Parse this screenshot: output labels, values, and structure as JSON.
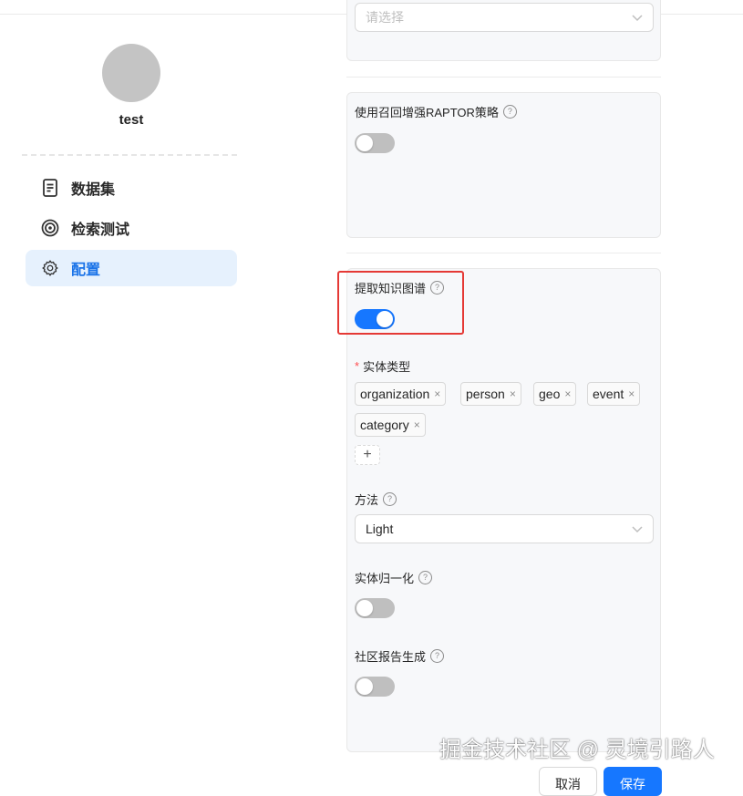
{
  "user": {
    "name": "test"
  },
  "sidebar": {
    "items": [
      {
        "label": "数据集",
        "icon": "document-icon",
        "active": false
      },
      {
        "label": "检索测试",
        "icon": "target-icon",
        "active": false
      },
      {
        "label": "配置",
        "icon": "gear-icon",
        "active": true
      }
    ]
  },
  "top_select": {
    "placeholder": "请选择"
  },
  "raptor": {
    "label": "使用召回增强RAPTOR策略",
    "enabled": false
  },
  "knowledge_graph": {
    "label": "提取知识图谱",
    "enabled": true,
    "entity_types": {
      "label": "实体类型",
      "required_mark": "*",
      "tags": [
        "organization",
        "person",
        "geo",
        "event",
        "category"
      ],
      "remove_glyph": "×",
      "add_glyph": "+"
    },
    "method": {
      "label": "方法",
      "value": "Light"
    },
    "entity_resolution": {
      "label": "实体归一化",
      "enabled": false
    },
    "community_report": {
      "label": "社区报告生成",
      "enabled": false
    }
  },
  "help_glyph": "?",
  "buttons": {
    "cancel": "取消",
    "save": "保存"
  },
  "watermark": "掘金技术社区 @ 灵境引路人",
  "colors": {
    "accent": "#1677ff",
    "active_nav_bg": "#e6f1fd",
    "highlight_box": "#e53935"
  }
}
